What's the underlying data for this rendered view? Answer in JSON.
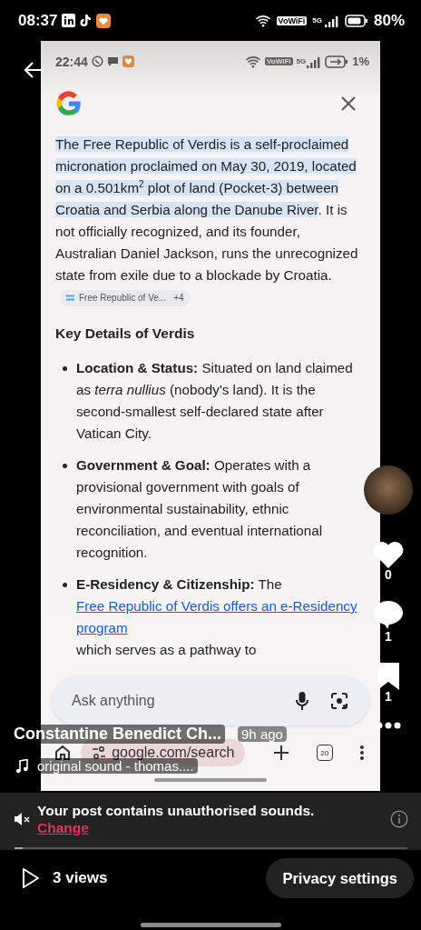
{
  "status_bar": {
    "time": "08:37",
    "network": "VoWiFi",
    "signal_label": "5G",
    "battery": "80%"
  },
  "screenshot": {
    "status_bar": {
      "time": "22:44",
      "network": "VoWiFi",
      "signal_label": "5G",
      "battery": "1%"
    },
    "answer": {
      "highlighted": "The Free Republic of Verdis is a self-proclaimed micronation proclaimed on May 30, 2019, located on a 0.501km$^{2}$ plot of land (Pocket-3) between Croatia and Serbia along the Danube River",
      "rest": ". It is not officially recognized, and its founder, Australian Daniel Jackson, runs the unrecognized state from exile due to a blockade by Croatia.",
      "source_chip": {
        "label": "Free Republic of Ve...",
        "count": "+4"
      }
    },
    "heading": "Key Details of Verdis",
    "bullets": [
      {
        "kind": "plain",
        "text": "**Location & Status:** Situated on land claimed as *terra nullius* (nobody's land). It is the second-smallest self-declared state after Vatican City."
      },
      {
        "kind": "plain",
        "text": "**Government & Goal:** Operates with a provisional government with goals of environmental sustainability, ethnic reconciliation, and eventual international recognition."
      },
      {
        "kind": "link",
        "text": "**E-Residency & Citizenship:** The ",
        "link": "Free Republic of Verdis offers an e-Residency program",
        "after": " which serves as a pathway to"
      }
    ],
    "search": {
      "placeholder": "Ask anything"
    },
    "toolbar": {
      "url": "google.com/search",
      "tab_count": "20"
    }
  },
  "post": {
    "author": "Constantine Benedict Ch...",
    "time": "9h ago",
    "sound": "original sound - thomas....",
    "likes": "0",
    "comments": "1",
    "saves": "1"
  },
  "notice": {
    "message": "Your post contains unauthorised sounds.",
    "action": "Change"
  },
  "progress": {
    "level": 0.02
  },
  "views": "3 views",
  "privacy_button": "Privacy settings"
}
